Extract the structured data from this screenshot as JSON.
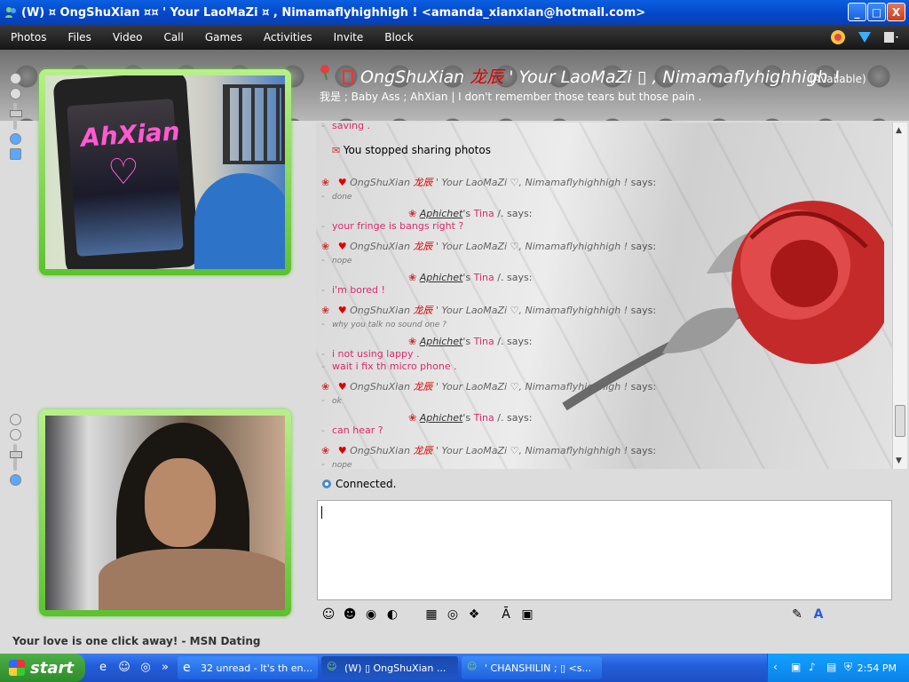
{
  "window": {
    "title": "(W)  ¤  OngShuXian ¤¤ ' Your LaoMaZi ¤ , Nimamaflyhighhigh !  <amanda_xianxian@hotmail.com>",
    "minimize": "_",
    "maximize": "□",
    "close": "X"
  },
  "menu": [
    "Photos",
    "Files",
    "Video",
    "Call",
    "Games",
    "Activities",
    "Invite",
    "Block"
  ],
  "header": {
    "contact_name_prefix": "OngShuXian",
    "contact_name_chinese": "龙辰",
    "contact_name_suffix": "' Your LaoMaZi ▯ , Nimamaflyhighhigh !",
    "status": "(Available)",
    "personal_message": "我是 ; Baby Ass ; AhXian  | I don't remember those tears but those pain ."
  },
  "chat": [
    {
      "type": "msg_me",
      "text": "saving ."
    },
    {
      "type": "system",
      "text": "You stopped sharing photos"
    },
    {
      "type": "says_contact",
      "name_a": "OngShuXian",
      "name_b": "龙辰",
      "name_c": "' Your LaoMaZi ♡, Nimamaflyhighhigh !",
      "suffix": "says:"
    },
    {
      "type": "msg_contact",
      "text": "done"
    },
    {
      "type": "says_me",
      "name_a": "Aphichet",
      "name_b": "'s",
      "name_c": "Tina",
      "name_d": "/.",
      "suffix": "says:"
    },
    {
      "type": "msg_me",
      "text": "your fringe is bangs right ?"
    },
    {
      "type": "says_contact",
      "name_a": "OngShuXian",
      "name_b": "龙辰",
      "name_c": "' Your LaoMaZi ♡, Nimamaflyhighhigh !",
      "suffix": "says:"
    },
    {
      "type": "msg_contact",
      "text": "nope"
    },
    {
      "type": "says_me",
      "name_a": "Aphichet",
      "name_b": "'s",
      "name_c": "Tina",
      "name_d": "/.",
      "suffix": "says:"
    },
    {
      "type": "msg_me",
      "text": "i'm bored !"
    },
    {
      "type": "says_contact",
      "name_a": "OngShuXian",
      "name_b": "龙辰",
      "name_c": "' Your LaoMaZi ♡, Nimamaflyhighhigh !",
      "suffix": "says:"
    },
    {
      "type": "msg_contact",
      "text": "why you talk no sound one ?"
    },
    {
      "type": "says_me",
      "name_a": "Aphichet",
      "name_b": "'s",
      "name_c": "Tina",
      "name_d": "/.",
      "suffix": "says:"
    },
    {
      "type": "msg_me",
      "text": "i not using lappy ."
    },
    {
      "type": "msg_me",
      "text": "wait i fix th micro phone ."
    },
    {
      "type": "says_contact",
      "name_a": "OngShuXian",
      "name_b": "龙辰",
      "name_c": "' Your LaoMaZi ♡, Nimamaflyhighhigh !",
      "suffix": "says:"
    },
    {
      "type": "msg_contact",
      "text": "ok"
    },
    {
      "type": "says_me",
      "name_a": "Aphichet",
      "name_b": "'s",
      "name_c": "Tina",
      "name_d": "/.",
      "suffix": "says:"
    },
    {
      "type": "msg_me",
      "text": "can hear ?"
    },
    {
      "type": "says_contact",
      "name_a": "OngShuXian",
      "name_b": "龙辰",
      "name_c": "' Your LaoMaZi ♡, Nimamaflyhighhigh !",
      "suffix": "says:"
    },
    {
      "type": "msg_contact",
      "text": "nope"
    }
  ],
  "webcam_text": "AhXian",
  "connection_status": "Connected.",
  "ad_text": "Your love is one click away! - MSN Dating",
  "taskbar": {
    "start": "start",
    "tasks": [
      {
        "label": "32 unread - It's th en..."
      },
      {
        "label": "(W)  ▯  OngShuXian ..."
      },
      {
        "label": "' CHANSHILIN ; ▯ <s..."
      }
    ],
    "clock": "2:54 PM"
  },
  "colors": {
    "accent_pink": "#d62b6a",
    "frame_green": "#5cc12f",
    "titlebar_blue": "#0a5fe0"
  }
}
